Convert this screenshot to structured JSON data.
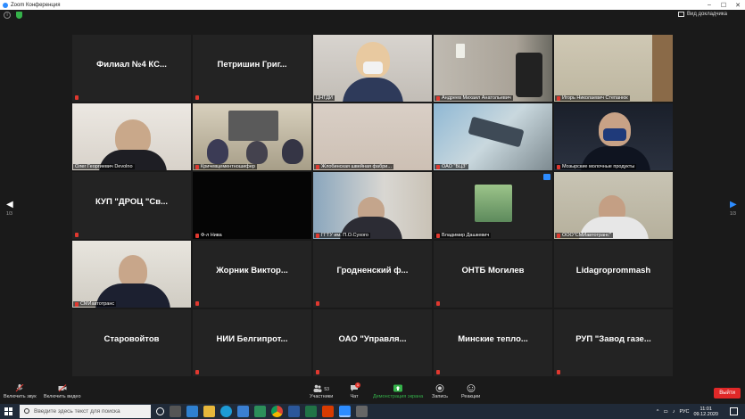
{
  "window": {
    "title": "Zoom Конференция",
    "view_label": "Вид докладчика"
  },
  "nav": {
    "page_left": "1/3",
    "page_right": "1/3"
  },
  "tiles": [
    {
      "type": "name",
      "text": "Филиал №4 КС..."
    },
    {
      "type": "name",
      "text": "Петришин Григ..."
    },
    {
      "type": "video",
      "label": "ЦНТДИ",
      "active": true
    },
    {
      "type": "video",
      "label": "Андреев Михаил Анатольевич"
    },
    {
      "type": "video",
      "label": "Игорь Николаевич Степанюк"
    },
    {
      "type": "video",
      "label": "Олег Георгиевич Devolno"
    },
    {
      "type": "video",
      "label": "Кричевцементношифер"
    },
    {
      "type": "video",
      "label": "Жлобинская швейная фабри..."
    },
    {
      "type": "video",
      "label": "ОАО \"БЦЗ\""
    },
    {
      "type": "video",
      "label": "Мозырские молочные продукты"
    },
    {
      "type": "name",
      "text": "КУП \"ДРОЦ \"Св..."
    },
    {
      "type": "video",
      "label": "Ф-л Нива"
    },
    {
      "type": "video",
      "label": "ГГТУ им. П.О.Сухого"
    },
    {
      "type": "video",
      "label": "Владимир Дашкевич"
    },
    {
      "type": "video",
      "label": "ООО\"СМИавтотранс\""
    },
    {
      "type": "video",
      "label": "СМИавтотранс"
    },
    {
      "type": "name",
      "text": "Жорник Виктор..."
    },
    {
      "type": "name",
      "text": "Гродненский ф..."
    },
    {
      "type": "name",
      "text": "ОНТБ Могилев"
    },
    {
      "type": "name",
      "text": "Lidagroprommash"
    },
    {
      "type": "name",
      "text": "Старовойтов"
    },
    {
      "type": "name",
      "text": "НИИ Белгипрот..."
    },
    {
      "type": "name",
      "text": "ОАО \"Управля..."
    },
    {
      "type": "name",
      "text": "Минские тепло..."
    },
    {
      "type": "name",
      "text": "РУП \"Завод газе..."
    }
  ],
  "toolbar": {
    "audio": "Включить звук",
    "video": "Включить видео",
    "participants": "Участники",
    "participants_count": "53",
    "chat": "Чат",
    "chat_badge": "1",
    "share": "Демонстрация экрана",
    "record": "Запись",
    "reactions": "Реакции",
    "leave": "Выйти"
  },
  "taskbar": {
    "search_placeholder": "Введите здесь текст для поиска",
    "lang": "РУС",
    "time": "11:01",
    "date": "09.12.2020"
  },
  "colors": {
    "accent": "#2d8cff",
    "mute": "#e0382f",
    "active_border": "#9acd32",
    "share": "#35b24a",
    "leave": "#e02828"
  }
}
